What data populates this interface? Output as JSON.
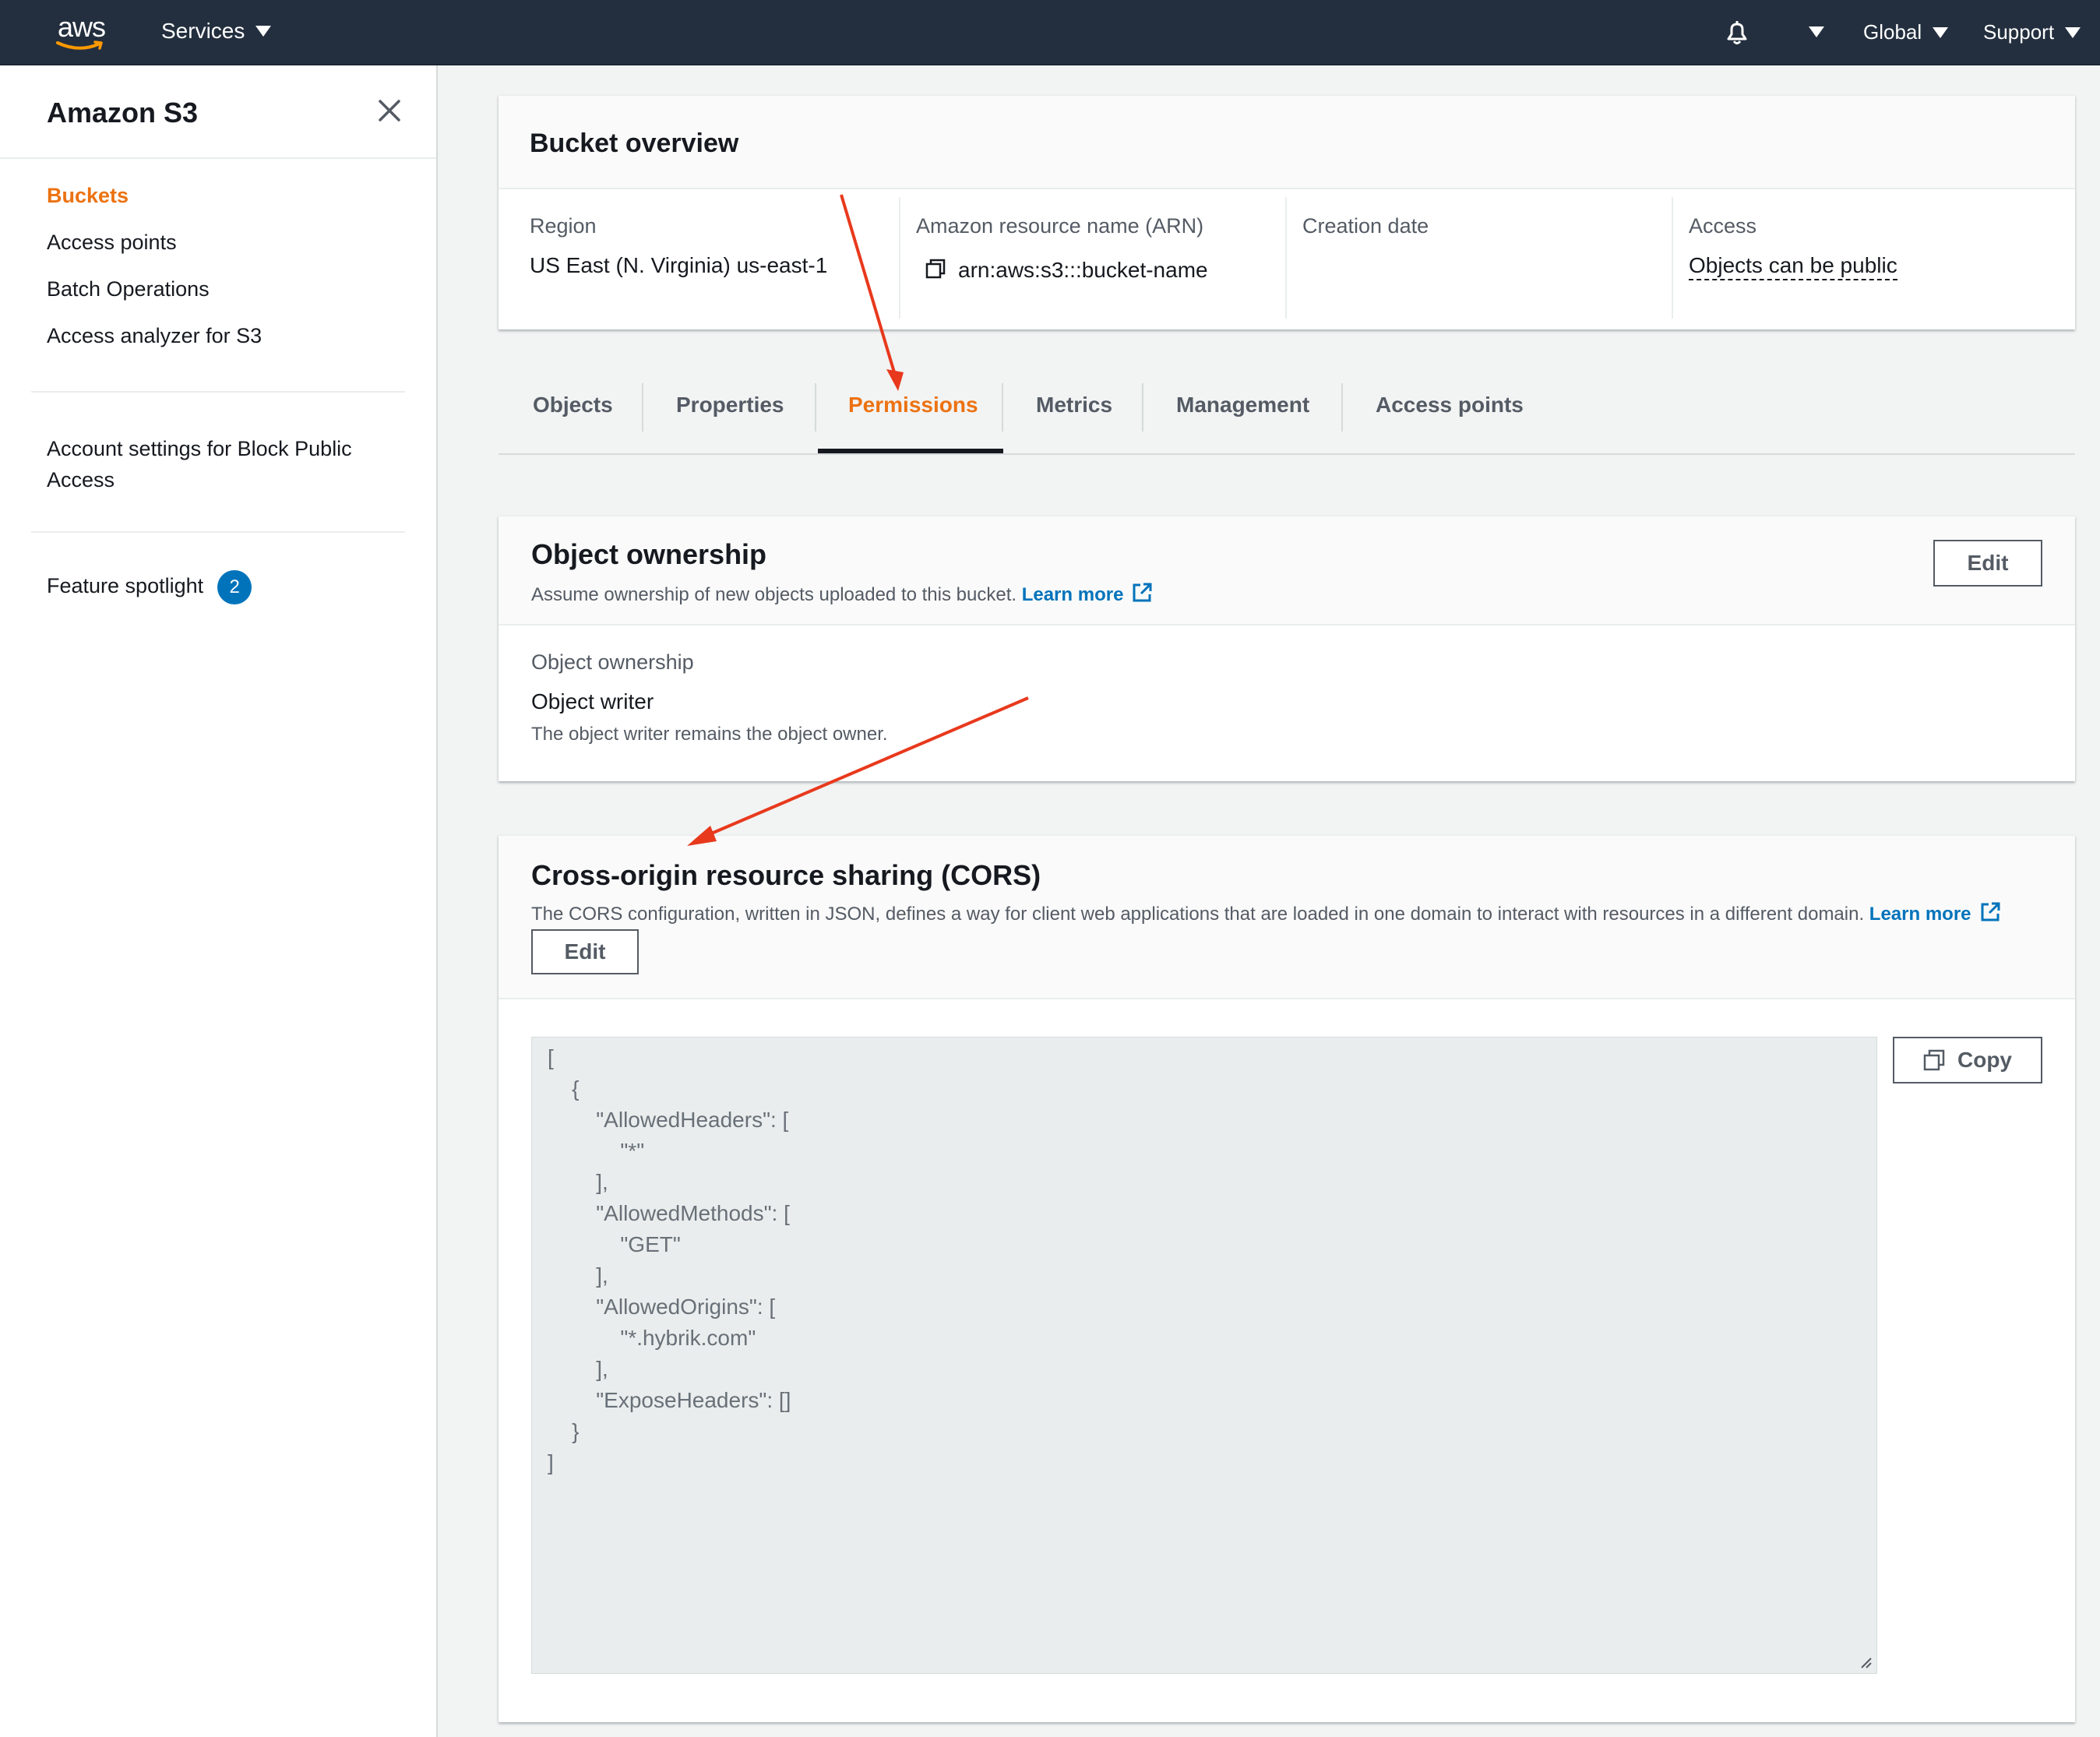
{
  "topnav": {
    "logo_text": "aws",
    "services_label": "Services",
    "region_label": "Global",
    "support_label": "Support"
  },
  "sidebar": {
    "title": "Amazon S3",
    "items": [
      {
        "label": "Buckets",
        "active": true
      },
      {
        "label": "Access points"
      },
      {
        "label": "Batch Operations"
      },
      {
        "label": "Access analyzer for S3"
      }
    ],
    "account_settings_line1": "Account settings for Block Public",
    "account_settings_line2": "Access",
    "feature_spotlight": "Feature spotlight",
    "feature_badge": "2"
  },
  "overview": {
    "title": "Bucket overview",
    "region_label": "Region",
    "region_value": "US East (N. Virginia) us-east-1",
    "arn_label": "Amazon resource name (ARN)",
    "arn_value": "arn:aws:s3:::bucket-name",
    "creation_label": "Creation date",
    "access_label": "Access",
    "access_value": "Objects can be public"
  },
  "tabs": [
    {
      "label": "Objects"
    },
    {
      "label": "Properties"
    },
    {
      "label": "Permissions",
      "active": true
    },
    {
      "label": "Metrics"
    },
    {
      "label": "Management"
    },
    {
      "label": "Access points"
    }
  ],
  "ownership": {
    "title": "Object ownership",
    "desc": "Assume ownership of new objects uploaded to this bucket.",
    "learn_more": "Learn more",
    "edit_label": "Edit",
    "field_label": "Object ownership",
    "field_value": "Object writer",
    "field_sub": "The object writer remains the object owner."
  },
  "cors": {
    "title": "Cross-origin resource sharing (CORS)",
    "desc": "The CORS configuration, written in JSON, defines a way for client web applications that are loaded in one domain to interact with resources in a different domain.",
    "learn_more": "Learn more",
    "edit_label": "Edit",
    "copy_label": "Copy",
    "code_lines": [
      "[",
      "    {",
      "        \"AllowedHeaders\": [",
      "            \"*\"",
      "        ],",
      "        \"AllowedMethods\": [",
      "            \"GET\"",
      "        ],",
      "        \"AllowedOrigins\": [",
      "            \"*.hybrik.com\"",
      "        ],",
      "        \"ExposeHeaders\": []",
      "    }",
      "]"
    ]
  },
  "colors": {
    "nav_bg": "#232f3e",
    "accent": "#ec7211",
    "link": "#0073bb",
    "annotation_arrow": "#e8391d"
  }
}
